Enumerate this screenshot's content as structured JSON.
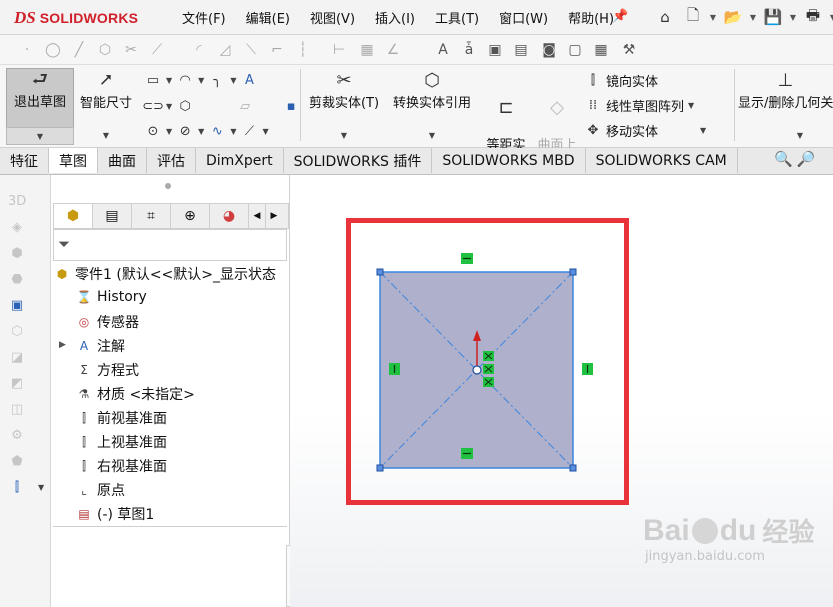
{
  "app": {
    "logo_ds": "DS",
    "logo_text": "SOLIDWORKS",
    "menus": [
      "文件(F)",
      "编辑(E)",
      "视图(V)",
      "插入(I)",
      "工具(T)",
      "窗口(W)",
      "帮助(H)"
    ]
  },
  "command_manager": {
    "exit_sketch": "退出草图",
    "smart_dimension": "智能尺寸",
    "trim_entities": "剪裁实体(T)",
    "convert_entities": "转换实体引用",
    "offset_entities": "等距实\n体",
    "offset_on_surface": "曲面上\n偏移",
    "mirror_entities": "镜向实体",
    "linear_pattern": "线性草图阵列",
    "move_entities": "移动实体",
    "show_hide_relations": "显示/删除几何关"
  },
  "tabs": [
    "特征",
    "草图",
    "曲面",
    "评估",
    "DimXpert",
    "SOLIDWORKS 插件",
    "SOLIDWORKS MBD",
    "SOLIDWORKS CAM"
  ],
  "active_tab": "草图",
  "tree": {
    "part": "零件1  (默认<<默认>_显示状态",
    "items": [
      {
        "label": "History",
        "icon": "history-icon"
      },
      {
        "label": "传感器",
        "icon": "sensor-icon"
      },
      {
        "label": "注解",
        "icon": "annotation-icon"
      },
      {
        "label": "方程式",
        "icon": "equation-icon"
      },
      {
        "label": "材质 <未指定>",
        "icon": "material-icon"
      },
      {
        "label": "前视基准面",
        "icon": "plane-icon"
      },
      {
        "label": "上视基准面",
        "icon": "plane-icon"
      },
      {
        "label": "右视基准面",
        "icon": "plane-icon"
      },
      {
        "label": "原点",
        "icon": "origin-icon"
      },
      {
        "label": "(-) 草图1",
        "icon": "sketch-icon"
      }
    ]
  },
  "watermark": {
    "brand": "Bai",
    "brand2": "du",
    "cn": "经验",
    "url": "jingyan.baidu.com"
  },
  "colors": {
    "highlight": "#e8333b",
    "sketch_fill": "#aeb0cc",
    "sketch_line": "#3c86e0",
    "relation_green": "#20c040",
    "accent_red": "#d0202a"
  }
}
